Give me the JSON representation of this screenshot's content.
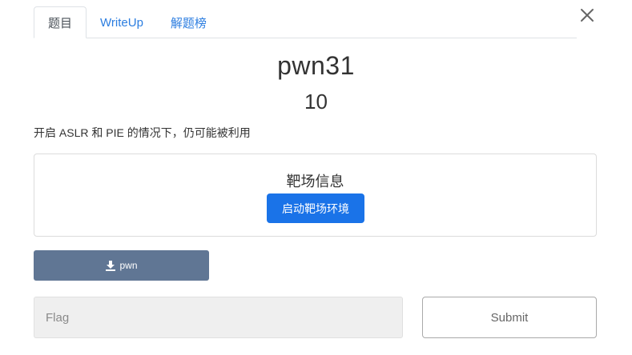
{
  "tabs": [
    {
      "label": "题目",
      "active": true
    },
    {
      "label": "WriteUp",
      "active": false
    },
    {
      "label": "解题榜",
      "active": false
    }
  ],
  "challenge": {
    "name": "pwn31",
    "value": "10",
    "description": "开启 ASLR 和 PIE 的情况下，仍可能被利用"
  },
  "environment": {
    "title": "靶场信息",
    "start_button": "启动靶场环境"
  },
  "download": {
    "label": "pwn",
    "icon": "download-icon"
  },
  "flag": {
    "placeholder": "Flag",
    "value": ""
  },
  "submit_label": "Submit",
  "colors": {
    "tab_link": "#2b7de0",
    "primary_button": "#1a73e8",
    "download_button": "#607694",
    "input_bg": "#efefef"
  }
}
